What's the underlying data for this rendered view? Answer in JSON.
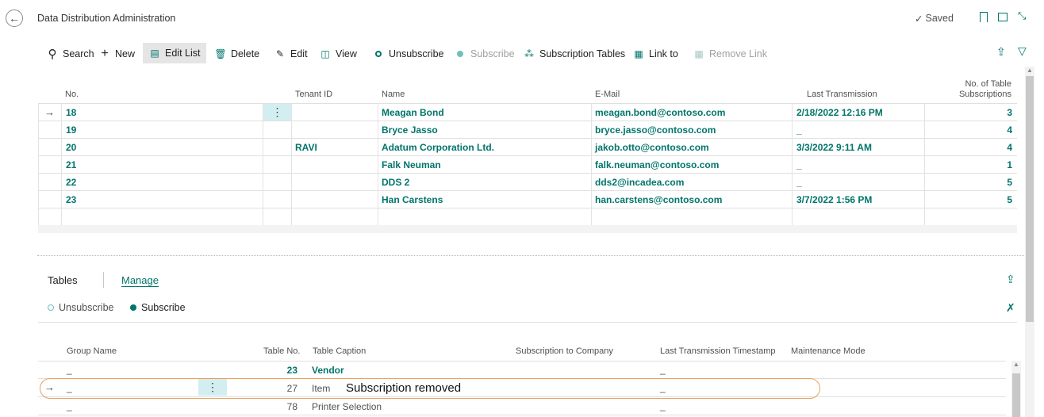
{
  "header": {
    "title": "Data Distribution Administration",
    "saved": "Saved"
  },
  "toolbar": {
    "search": "Search",
    "new": "New",
    "edit_list": "Edit List",
    "delete": "Delete",
    "edit": "Edit",
    "view": "View",
    "unsubscribe": "Unsubscribe",
    "subscribe": "Subscribe",
    "subscription_tables": "Subscription Tables",
    "link_to": "Link to",
    "remove_link": "Remove Link"
  },
  "main_table": {
    "columns": {
      "no": "No.",
      "tenant": "Tenant ID",
      "name": "Name",
      "email": "E-Mail",
      "last": "Last Transmission",
      "subs_1": "No. of Table",
      "subs_2": "Subscriptions"
    },
    "rows": [
      {
        "no": "18",
        "tenant": "",
        "name": "Meagan Bond",
        "email": "meagan.bond@contoso.com",
        "last": "2/18/2022 12:16 PM",
        "subs": "3"
      },
      {
        "no": "19",
        "tenant": "",
        "name": "Bryce Jasso",
        "email": "bryce.jasso@contoso.com",
        "last": "_",
        "subs": "4"
      },
      {
        "no": "20",
        "tenant": "RAVI",
        "name": "Adatum Corporation Ltd.",
        "email": "jakob.otto@contoso.com",
        "last": "3/3/2022 9:11 AM",
        "subs": "4"
      },
      {
        "no": "21",
        "tenant": "",
        "name": "Falk Neuman",
        "email": "falk.neuman@contoso.com",
        "last": "_",
        "subs": "1"
      },
      {
        "no": "22",
        "tenant": "",
        "name": "DDS 2",
        "email": "dds2@incadea.com",
        "last": "_",
        "subs": "5"
      },
      {
        "no": "23",
        "tenant": "",
        "name": "Han Carstens",
        "email": "han.carstens@contoso.com",
        "last": "3/7/2022 1:56 PM",
        "subs": "5"
      }
    ]
  },
  "subpage": {
    "tab_tables": "Tables",
    "tab_manage": "Manage",
    "unsubscribe": "Unsubscribe",
    "subscribe": "Subscribe",
    "columns": {
      "group": "Group Name",
      "table_no": "Table No.",
      "caption": "Table Caption",
      "sub_company": "Subscription to Company",
      "last_ts": "Last Transmission Timestamp",
      "maint": "Maintenance Mode"
    },
    "rows": [
      {
        "group": "_",
        "table_no": "23",
        "caption": "Vendor",
        "last_ts": "_"
      },
      {
        "group": "_",
        "table_no": "27",
        "caption": "Item",
        "last_ts": "_"
      },
      {
        "group": "_",
        "table_no": "78",
        "caption": "Printer Selection",
        "last_ts": "_"
      }
    ],
    "annotation": "Subscription removed"
  },
  "colors": {
    "accent": "#00756b",
    "selected_cell": "#d3eef0",
    "annotation_border": "#e8a060"
  }
}
